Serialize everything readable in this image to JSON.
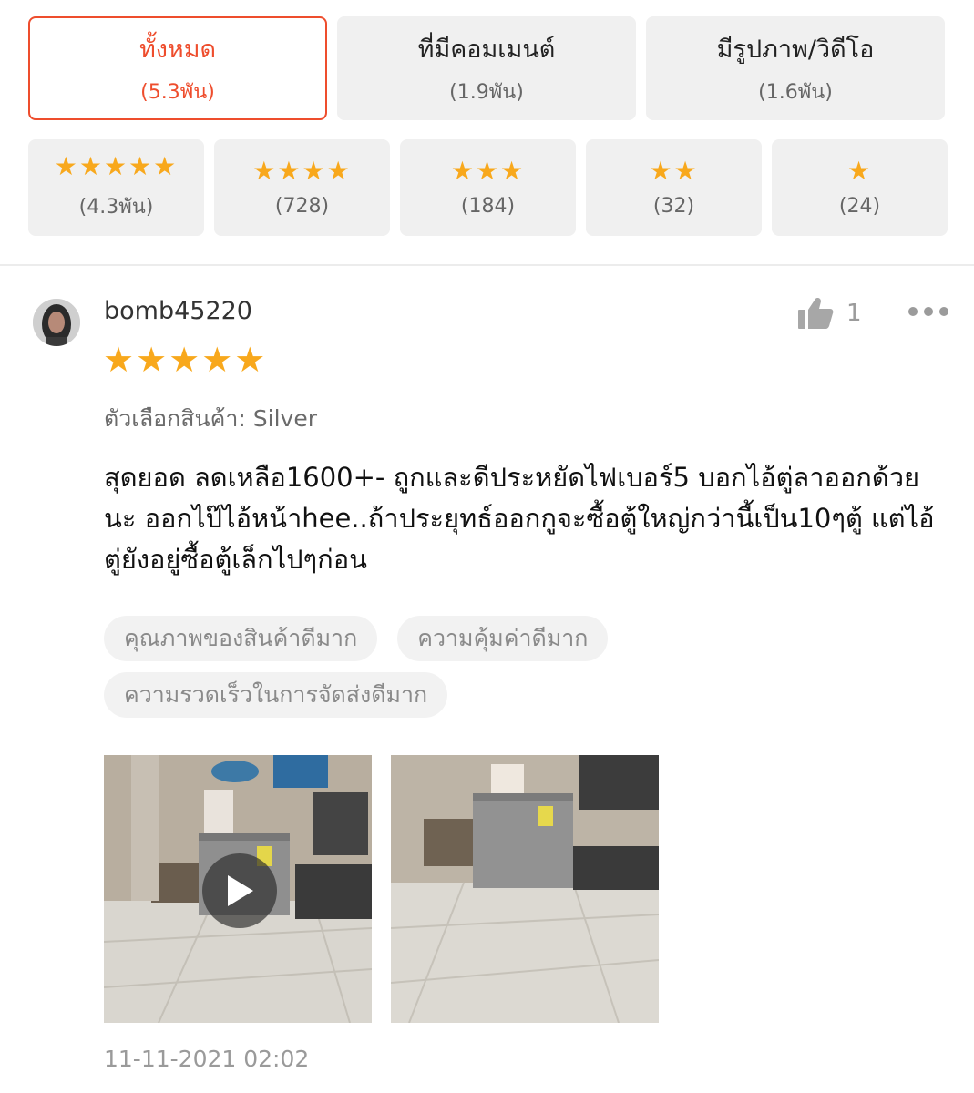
{
  "filters": [
    {
      "label": "ทั้งหมด",
      "count": "(5.3พัน)",
      "active": true
    },
    {
      "label": "ที่มีคอมเมนต์",
      "count": "(1.9พัน)",
      "active": false
    },
    {
      "label": "มีรูปภาพ/วิดีโอ",
      "count": "(1.6พัน)",
      "active": false
    }
  ],
  "star_filters": [
    {
      "stars": "★★★★★",
      "count": "(4.3พัน)"
    },
    {
      "stars": "★★★★",
      "count": "(728)"
    },
    {
      "stars": "★★★",
      "count": "(184)"
    },
    {
      "stars": "★★",
      "count": "(32)"
    },
    {
      "stars": "★",
      "count": "(24)"
    }
  ],
  "review": {
    "username": "bomb45220",
    "likes": "1",
    "rating_stars": "★★★★★",
    "rating": 5,
    "variation": "ตัวเลือกสินค้า: Silver",
    "comment": "สุดยอด ลดเหลือ1600+- ถูกและดีประหยัดไฟเบอร์5 บอกไอ้ตู่ลาออกด้วยนะ ออกไป๊ไอ้หน้าhee..ถ้าประยุทธ์ออกกูจะซื้อตู้ใหญ่กว่านี้เป็น10ๆตู้ แต่ไอ้ตู่ยังอยู่ซื้อตู้เล็กไปๆก่อน",
    "tags": [
      "คุณภาพของสินค้าดีมาก",
      "ความคุ้มค่าดีมาก",
      "ความรวดเร็วในการจัดส่งดีมาก"
    ],
    "date": "11-11-2021 02:02"
  },
  "colors": {
    "accent": "#ee4d2d",
    "star": "#f8a81c",
    "chip_bg": "#f0f0f0"
  },
  "icons": [
    "thumbs-up-icon",
    "more-icon",
    "play-icon",
    "star-icon"
  ]
}
